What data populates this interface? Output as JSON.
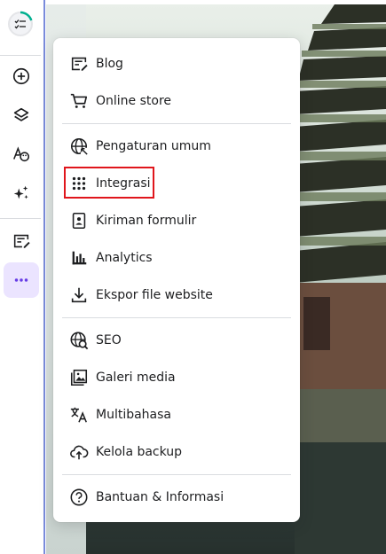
{
  "sidebar": {
    "tools": [
      {
        "name": "add-element-icon"
      },
      {
        "name": "layers-icon"
      },
      {
        "name": "styles-icon"
      },
      {
        "name": "ai-tools-icon"
      },
      {
        "name": "blog-edit-icon"
      },
      {
        "name": "more-icon"
      }
    ],
    "progress_fraction": 0.3,
    "accent": "#673de6"
  },
  "menu": {
    "items": [
      {
        "label": "Blog",
        "icon": "blog-edit-icon"
      },
      {
        "label": "Online store",
        "icon": "cart-icon"
      },
      {
        "label": "Pengaturan umum",
        "icon": "globe-settings-icon"
      },
      {
        "label": "Integrasi",
        "icon": "grid-dots-icon"
      },
      {
        "label": "Kiriman formulir",
        "icon": "form-submission-icon"
      },
      {
        "label": "Analytics",
        "icon": "bar-chart-icon"
      },
      {
        "label": "Ekspor file website",
        "icon": "download-icon"
      },
      {
        "label": "SEO",
        "icon": "seo-search-icon"
      },
      {
        "label": "Galeri media",
        "icon": "gallery-icon"
      },
      {
        "label": "Multibahasa",
        "icon": "translate-icon"
      },
      {
        "label": "Kelola backup",
        "icon": "cloud-backup-icon"
      },
      {
        "label": "Bantuan & Informasi",
        "icon": "help-icon"
      }
    ],
    "highlighted_item": "Integrasi",
    "highlight_color": "#e0161c"
  }
}
